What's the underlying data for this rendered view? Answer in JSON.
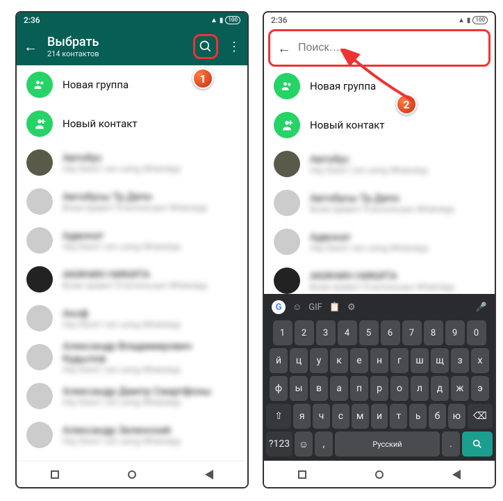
{
  "status": {
    "time": "2:36",
    "battery": "100"
  },
  "phone1": {
    "header": {
      "title": "Выбрать",
      "subtitle": "214 контактов"
    },
    "actions": {
      "new_group": "Новая группа",
      "new_contact": "Новый контакт"
    },
    "contacts": [
      {
        "name": "Автобус",
        "sub": "Hey there! I am using WhatsApp"
      },
      {
        "name": "Автобусы Тр.Депо",
        "sub": "Всем привет! Я использую WhatsApp"
      },
      {
        "name": "Адвокат",
        "sub": "Hey there! I am using WhatsApp"
      },
      {
        "name": "АКИНИН НИКИТА",
        "sub": "Всем привет! Я использую WhatsApp"
      },
      {
        "name": "Акоф",
        "sub": "Hey there! I am using WhatsApp"
      },
      {
        "name": "Александр Владимирович Кудылов",
        "sub": "Hey there! I am using WhatsApp"
      },
      {
        "name": "Александр Дмитр Смартфоны",
        "sub": "Hey there! I am using WhatsApp"
      },
      {
        "name": "Александр Зеленский",
        "sub": "Hey there! I am using WhatsApp"
      }
    ]
  },
  "phone2": {
    "search_placeholder": "Поиск…",
    "actions": {
      "new_group": "Новая группа",
      "new_contact": "Новый контакт"
    },
    "contacts": [
      {
        "name": "Автобус",
        "sub": "Hey there! I am using WhatsApp"
      },
      {
        "name": "Автобусы Тр.Депо",
        "sub": "Всем привет! Я использую WhatsApp"
      },
      {
        "name": "Адвокат",
        "sub": "Hey there! I am using WhatsApp"
      },
      {
        "name": "АКИНИН НИКИТА",
        "sub": "Всем привет! Я использую WhatsApp"
      }
    ]
  },
  "keyboard": {
    "nums": [
      "1",
      "2",
      "3",
      "4",
      "5",
      "6",
      "7",
      "8",
      "9",
      "0"
    ],
    "row1": [
      "й",
      "ц",
      "у",
      "к",
      "е",
      "н",
      "г",
      "ш",
      "щ",
      "з",
      "х"
    ],
    "row2": [
      "ф",
      "ы",
      "в",
      "а",
      "п",
      "р",
      "о",
      "л",
      "д",
      "ж",
      "э"
    ],
    "row3": [
      "я",
      "ч",
      "с",
      "м",
      "и",
      "т",
      "ь",
      "б",
      "ю"
    ],
    "sym": "?123",
    "lang": "Русский",
    "top": [
      "GIF"
    ]
  },
  "markers": {
    "m1": "1",
    "m2": "2"
  }
}
